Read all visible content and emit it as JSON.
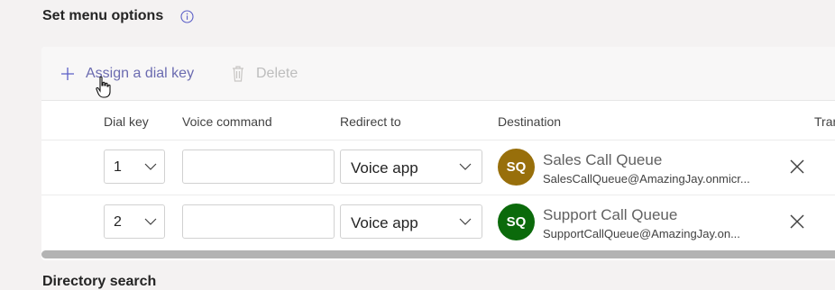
{
  "section": {
    "title": "Set menu options"
  },
  "toolbar": {
    "assign_label": "Assign a dial key",
    "delete_label": "Delete"
  },
  "table": {
    "columns": [
      "Dial key",
      "Voice command",
      "Redirect to",
      "Destination",
      "Tran"
    ],
    "rows": [
      {
        "dial_key": "1",
        "voice_command": "",
        "redirect": "Voice app",
        "avatar": "SQ",
        "avatar_color": "#986f0b",
        "dest_name": "Sales Call Queue",
        "dest_email": "SalesCallQueue@AmazingJay.onmicr..."
      },
      {
        "dial_key": "2",
        "voice_command": "",
        "redirect": "Voice app",
        "avatar": "SQ",
        "avatar_color": "#0b6a0b",
        "dest_name": "Support Call Queue",
        "dest_email": "SupportCallQueue@AmazingJay.on..."
      }
    ]
  },
  "next_section": {
    "title": "Directory search"
  },
  "colors": {
    "accent": "#5b5fc7",
    "background": "#f4f2f2"
  },
  "icons": [
    "info-icon",
    "plus-icon",
    "trash-icon",
    "chevron-down-icon",
    "close-icon",
    "hand-cursor-icon"
  ]
}
